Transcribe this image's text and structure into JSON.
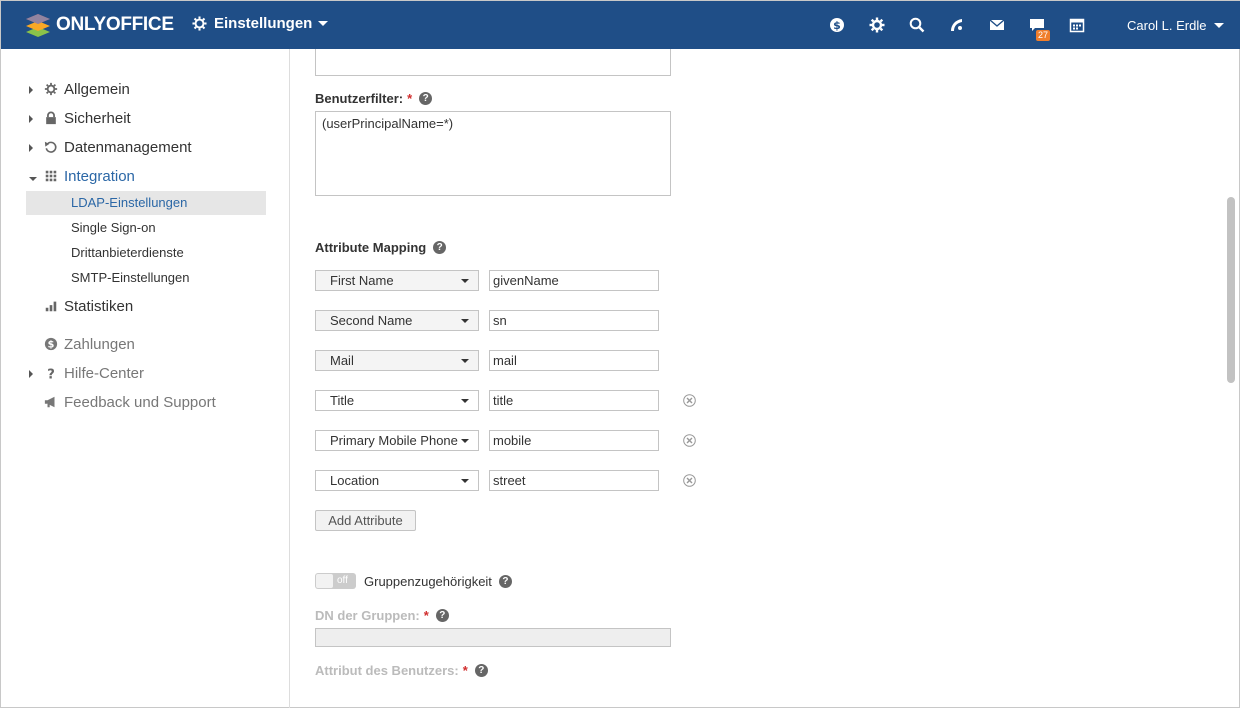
{
  "header": {
    "logo_text": "ONLYOFFICE",
    "module": "Einstellungen",
    "icons": [
      "dollar-icon",
      "settings-icon",
      "search-icon",
      "feed-icon",
      "mail-icon",
      "chat-icon",
      "calendar-icon"
    ],
    "chat_badge": "27",
    "user": "Carol L. Erdle",
    "colors": {
      "bar": "#1f4e87",
      "badge": "#f07e2c"
    }
  },
  "sidebar": {
    "groups": [
      {
        "label": "Allgemein",
        "icon": "gear-icon"
      },
      {
        "label": "Sicherheit",
        "icon": "lock-icon"
      },
      {
        "label": "Datenmanagement",
        "icon": "restore-icon"
      },
      {
        "label": "Integration",
        "icon": "grid-icon"
      }
    ],
    "integration_items": [
      {
        "label": "LDAP-Einstellungen",
        "selected": true
      },
      {
        "label": "Single Sign-on"
      },
      {
        "label": "Drittanbieterdienste"
      },
      {
        "label": "SMTP-Einstellungen"
      }
    ],
    "statistics": {
      "label": "Statistiken",
      "icon": "chart-icon"
    },
    "payments": {
      "label": "Zahlungen",
      "icon": "dollar-icon"
    },
    "help": {
      "label": "Hilfe-Center",
      "icon": "question-icon"
    },
    "feedback": {
      "label": "Feedback und Support",
      "icon": "megaphone-icon"
    }
  },
  "main": {
    "user_filter_label": "Benutzerfilter:",
    "required_mark": "*",
    "user_filter_value": "(userPrincipalName=*)",
    "attribute_mapping_label": "Attribute Mapping",
    "mappings": [
      {
        "field": "First Name",
        "value": "givenName",
        "removable": false
      },
      {
        "field": "Second Name",
        "value": "sn",
        "removable": false
      },
      {
        "field": "Mail",
        "value": "mail",
        "removable": false
      },
      {
        "field": "Title",
        "value": "title",
        "removable": true
      },
      {
        "field": "Primary Mobile Phone",
        "value": "mobile",
        "removable": true
      },
      {
        "field": "Location",
        "value": "street",
        "removable": true
      }
    ],
    "add_attribute_button": "Add Attribute",
    "group_toggle_state": "off",
    "group_membership_label": "Gruppenzugehörigkeit",
    "group_dn_label": "DN der Gruppen:",
    "user_attribute_label": "Attribut des Benutzers:"
  }
}
